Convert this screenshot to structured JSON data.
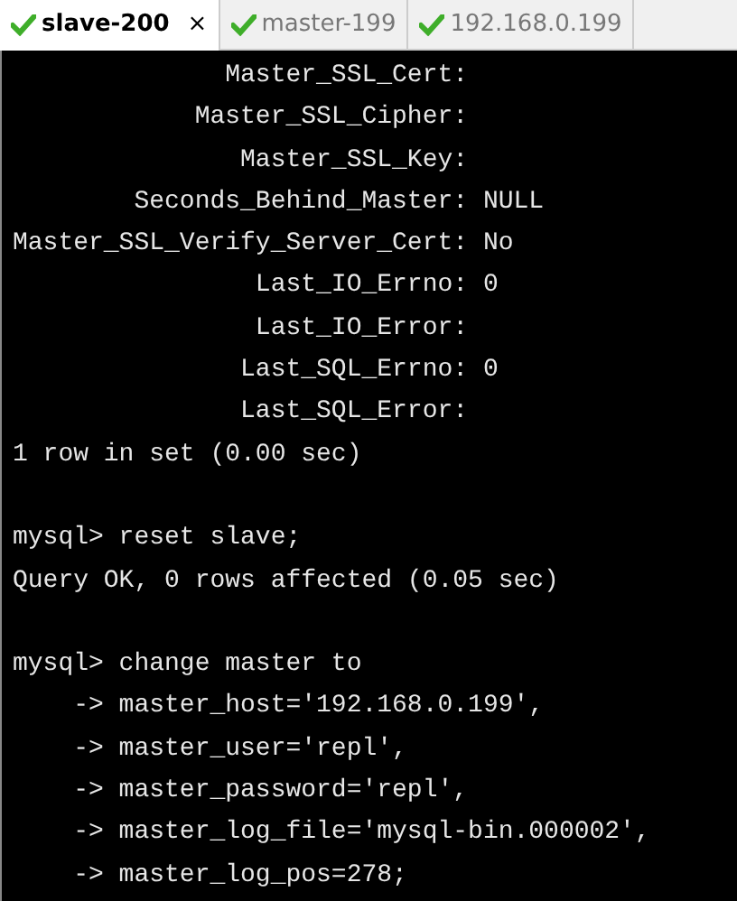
{
  "tabs": [
    {
      "label": "slave-200",
      "selected": true,
      "close": "×"
    },
    {
      "label": "master-199",
      "selected": false
    },
    {
      "label": "192.168.0.199",
      "selected": false
    }
  ],
  "terminal": {
    "blocks": [
      [
        "              Master_SSL_Cert:",
        "            Master_SSL_Cipher:",
        "               Master_SSL_Key:",
        "        Seconds_Behind_Master: NULL",
        "Master_SSL_Verify_Server_Cert: No",
        "                Last_IO_Errno: 0",
        "                Last_IO_Error:",
        "               Last_SQL_Errno: 0",
        "               Last_SQL_Error:",
        "1 row in set (0.00 sec)"
      ],
      [
        "mysql> reset slave;",
        "Query OK, 0 rows affected (0.05 sec)"
      ],
      [
        "mysql> change master to",
        "    -> master_host='192.168.0.199',",
        "    -> master_user='repl',",
        "    -> master_password='repl',",
        "    -> master_log_file='mysql-bin.000002',",
        "    -> master_log_pos=278;"
      ]
    ]
  }
}
